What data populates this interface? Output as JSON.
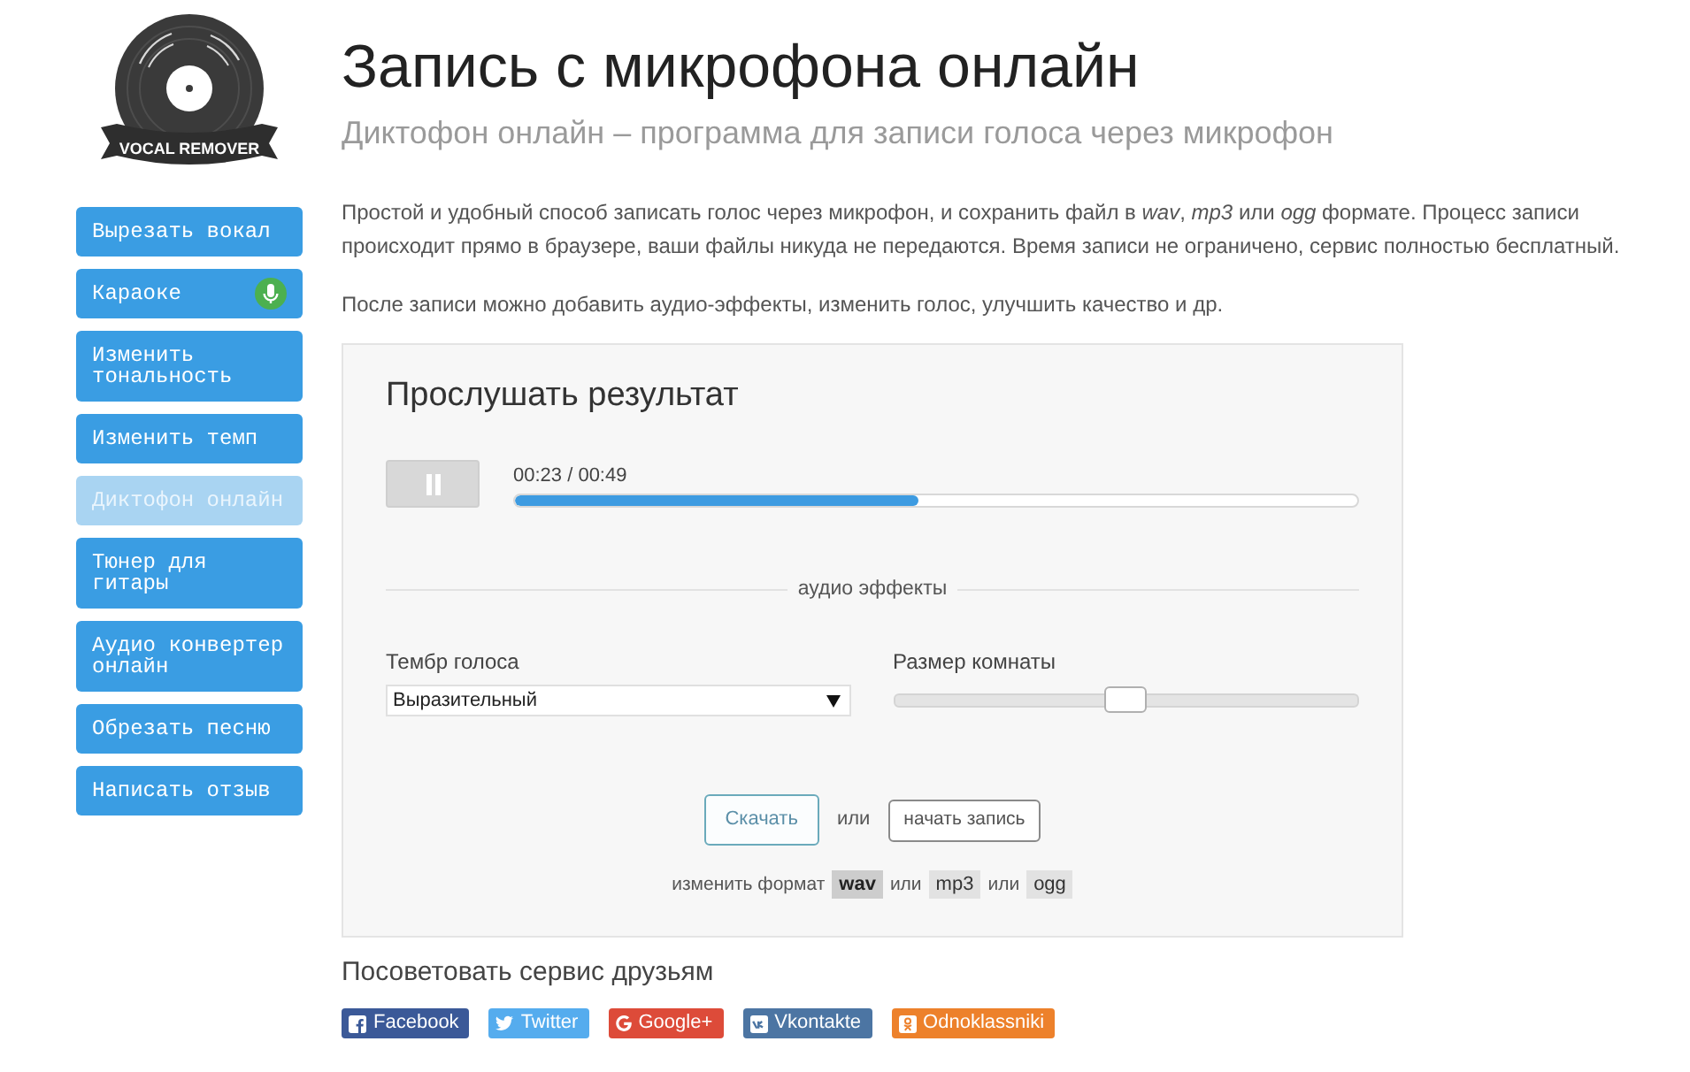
{
  "logo": {
    "text": "VOCAL REMOVER"
  },
  "sidebar": {
    "items": [
      {
        "label": "Вырезать вокал",
        "kind": "plain",
        "selected": false
      },
      {
        "label": "Караоке",
        "kind": "mic",
        "selected": false
      },
      {
        "label": "Изменить тональность",
        "kind": "plain",
        "selected": false
      },
      {
        "label": "Изменить темп",
        "kind": "plain",
        "selected": false
      },
      {
        "label": "Диктофон онлайн",
        "kind": "plain",
        "selected": true
      },
      {
        "label": "Тюнер для гитары",
        "kind": "plain",
        "selected": false
      },
      {
        "label": "Аудио конвертер онлайн",
        "kind": "plain",
        "selected": false
      },
      {
        "label": "Обрезать песню",
        "kind": "plain",
        "selected": false
      },
      {
        "label": "Написать отзыв",
        "kind": "plain",
        "selected": false
      }
    ]
  },
  "header": {
    "title": "Запись с микрофона онлайн",
    "subtitle": "Диктофон онлайн – программа для записи голоса через микрофон"
  },
  "intro": [
    "Простой и удобный способ записать голос через микрофон, и сохранить файл в *wav*, *mp3* или *ogg* формате. Процесс записи происходит прямо в браузере, ваши файлы никуда не передаются. Время записи не ограничено, сервис полностью бесплатный.",
    "После записи можно добавить аудио-эффекты, изменить голос, улучшить качество и др."
  ],
  "player": {
    "title": "Прослушать результат",
    "playing": true,
    "time": "00:23 / 00:49",
    "level": 0.478
  },
  "effects": {
    "heading": "аудио эффекты",
    "voice": {
      "label": "Тембр голоса",
      "value": "Выразительный"
    },
    "room": {
      "label": "Размер комнаты",
      "level": 0.5
    }
  },
  "actions": {
    "download": "Скачать",
    "separator": "или",
    "record": "начать запись"
  },
  "format": {
    "label": "изменить формат",
    "options": [
      {
        "label": "wav",
        "selected": true
      },
      {
        "label": "mp3",
        "selected": false
      },
      {
        "label": "ogg",
        "selected": false
      }
    ],
    "separators": [
      "или",
      "или"
    ]
  },
  "share": {
    "title": "Посоветовать сервис друзьям",
    "buttons": [
      {
        "label": "Facebook",
        "kind": "facebook",
        "color": "#3b5998"
      },
      {
        "label": "Twitter",
        "kind": "twitter",
        "color": "#55acee"
      },
      {
        "label": "Google+",
        "kind": "google",
        "color": "#dd4b39"
      },
      {
        "label": "Vkontakte",
        "kind": "vk",
        "color": "#4c75a3"
      },
      {
        "label": "Odnoklassniki",
        "kind": "ok",
        "color": "#ed812b"
      }
    ]
  }
}
